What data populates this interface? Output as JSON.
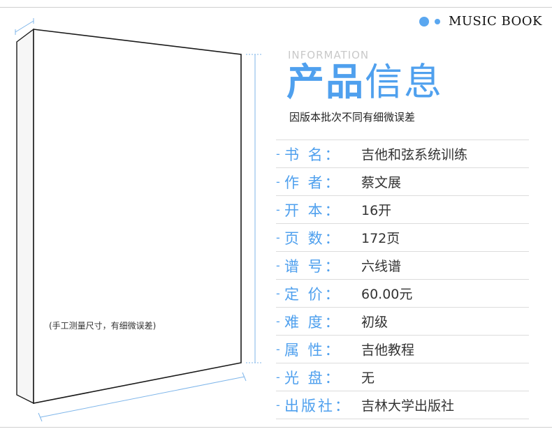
{
  "brand": {
    "name": "MUSIC BOOK",
    "accent": "#5aa7f0"
  },
  "book": {
    "measure_note": "(手工测量尺寸，有细微误差)"
  },
  "info": {
    "eyebrow": "INFORMATION",
    "title_bold": "产品",
    "title_light": "信息",
    "note": "因版本批次不同有细微误差"
  },
  "specs": [
    {
      "label": "书  名：",
      "value": "吉他和弦系统训练"
    },
    {
      "label": "作  者：",
      "value": "蔡文展"
    },
    {
      "label": "开  本：",
      "value": "16开"
    },
    {
      "label": "页  数：",
      "value": "172页"
    },
    {
      "label": "谱  号：",
      "value": "六线谱"
    },
    {
      "label": "定  价：",
      "value": "60.00元"
    },
    {
      "label": "难  度：",
      "value": "初级"
    },
    {
      "label": "属  性：",
      "value": "吉他教程"
    },
    {
      "label": "光  盘：",
      "value": "无"
    },
    {
      "label": "出版社：",
      "value": "吉林大学出版社"
    }
  ]
}
